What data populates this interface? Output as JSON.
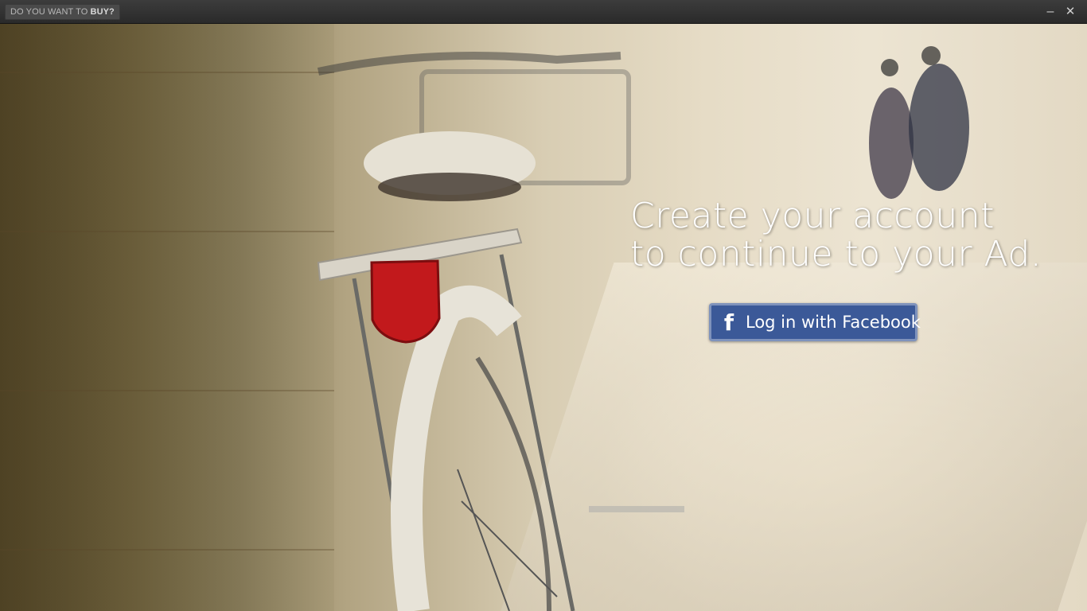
{
  "titlebar": {
    "badge_prefix": "DO YOU WANT TO",
    "badge_emphasis": "BUY?",
    "minimize_icon": "minimize-icon",
    "close_icon": "close-icon"
  },
  "main": {
    "headline_line1": "Create your account",
    "headline_line2": "to continue to your Ad.",
    "facebook_button": {
      "icon": "facebook-icon",
      "label": "Log in with Facebook",
      "color": "#3b5998"
    }
  }
}
